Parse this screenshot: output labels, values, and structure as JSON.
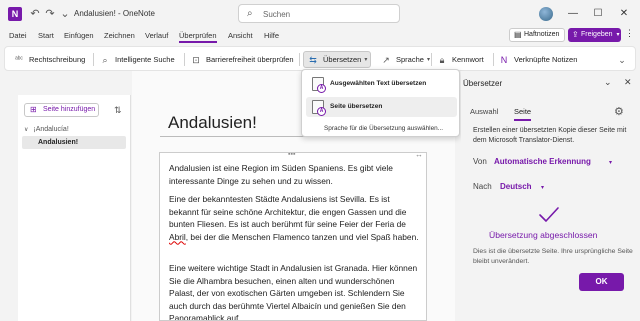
{
  "window": {
    "title": "Andalusien! - OneNote",
    "app_icon": "onenote-icon",
    "search_placeholder": "Suchen"
  },
  "menu": {
    "tabs": [
      "Datei",
      "Start",
      "Einfügen",
      "Zeichnen",
      "Verlauf",
      "Überprüfen",
      "Ansicht",
      "Hilfe"
    ],
    "active_tab": "Überprüfen",
    "haftnotizen": "Haftnotizen",
    "freigeben": "Freigeben"
  },
  "ribbon": {
    "rechtschreibung": "Rechtschreibung",
    "intelligente_suche": "Intelligente Suche",
    "barrierefreiheit": "Barrierefreiheit überprüfen",
    "uebersetzen": "Übersetzen",
    "sprache": "Sprache",
    "kennwort": "Kennwort",
    "verknuepfte_notizen": "Verknüpfte Notizen"
  },
  "dropdown": {
    "items": [
      {
        "label": "Ausgewählten Text übersetzen"
      },
      {
        "label": "Seite übersetzen"
      }
    ],
    "language_option": "Sprache für die Übersetzung auswählen..."
  },
  "nav": {
    "add_page": "Seite hinzufügen",
    "section": "¡Andalucía!",
    "page": "Andalusien!"
  },
  "page": {
    "title": "Andalusien!",
    "paragraphs": [
      "Andalusien ist eine Region im Süden Spaniens. Es gibt viele interessante Dinge zu sehen und zu wissen.",
      "Eine der bekanntesten Städte Andalusiens ist Sevilla. Es ist bekannt für seine schöne Architektur, die engen Gassen und die bunten Fliesen. Es ist auch berühmt für seine Feier der Feria de Abril, bei der die Menschen Flamenco tanzen und viel Spaß haben.",
      "Eine weitere wichtige Stadt in Andalusien ist Granada. Hier können Sie die Alhambra besuchen, einen alten und wunderschönen Palast, der von exotischen Gärten umgeben ist. Schlendern Sie auch durch das berühmte Viertel Albaicín und genießen Sie den Panoramablick auf"
    ]
  },
  "translator": {
    "title": "Übersetzer",
    "tabs": [
      "Auswahl",
      "Seite"
    ],
    "active_tab": "Seite",
    "description": "Erstellen einer übersetzten Kopie dieser Seite mit dem Microsoft Translator-Dienst.",
    "from_label": "Von",
    "from_value": "Automatische Erkennung",
    "to_label": "Nach",
    "to_value": "Deutsch",
    "done_title": "Übersetzung abgeschlossen",
    "done_desc": "Dies ist die übersetzte Seite. Ihre ursprüngliche Seite bleibt unverändert.",
    "ok_label": "OK"
  },
  "colors": {
    "accent": "#7719aa",
    "background": "#f3f3f3"
  }
}
